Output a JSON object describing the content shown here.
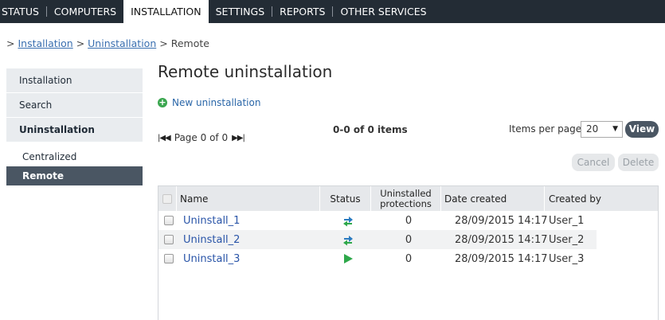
{
  "topnav": [
    {
      "label": "STATUS",
      "active": false
    },
    {
      "label": "COMPUTERS",
      "active": false
    },
    {
      "label": "INSTALLATION",
      "active": true
    },
    {
      "label": "SETTINGS",
      "active": false
    },
    {
      "label": "REPORTS",
      "active": false
    },
    {
      "label": "OTHER SERVICES",
      "active": false
    }
  ],
  "breadcrumb": {
    "prefix": ">",
    "items": [
      "Installation",
      "Uninstallation"
    ],
    "separator": ">",
    "current": "Remote"
  },
  "sidebar": {
    "items": [
      "Installation",
      "Search",
      "Uninstallation"
    ],
    "subitems": [
      "Centralized",
      "Remote"
    ]
  },
  "main": {
    "title": "Remote uninstallation",
    "new_link": "New uninstallation"
  },
  "pager": {
    "first": "|◀◀",
    "text": "Page 0 of 0",
    "last": "▶▶|",
    "items_count": "0-0 of 0 items",
    "items_per_page_label": "Items per page",
    "items_per_page_value": "20",
    "view_label": "View"
  },
  "actions": {
    "cancel": "Cancel",
    "delete": "Delete"
  },
  "table": {
    "headers": {
      "name": "Name",
      "status": "Status",
      "uninstalled_line1": "Uninstalled",
      "uninstalled_line2": "protections",
      "date": "Date created",
      "created_by": "Created by"
    },
    "rows": [
      {
        "name": "Uninstall_1",
        "status_icon": "in-progress-arrows-icon",
        "uninstalled": "0",
        "date": "28/09/2015 14:17",
        "created_by": "User_1"
      },
      {
        "name": "Uninstall_2",
        "status_icon": "in-progress-arrows-icon",
        "uninstalled": "0",
        "date": "28/09/2015 14:17",
        "created_by": "User_2"
      },
      {
        "name": "Uninstall_3",
        "status_icon": "play-icon",
        "uninstalled": "0",
        "date": "28/09/2015 14:17",
        "created_by": "User_3"
      }
    ]
  },
  "colors": {
    "nav_bg": "#232c35",
    "accent_dark": "#4a5663",
    "link": "#2a55a8",
    "add_green": "#3aa64f",
    "status_blue": "#2a7bc0",
    "status_green": "#2ea84a"
  }
}
